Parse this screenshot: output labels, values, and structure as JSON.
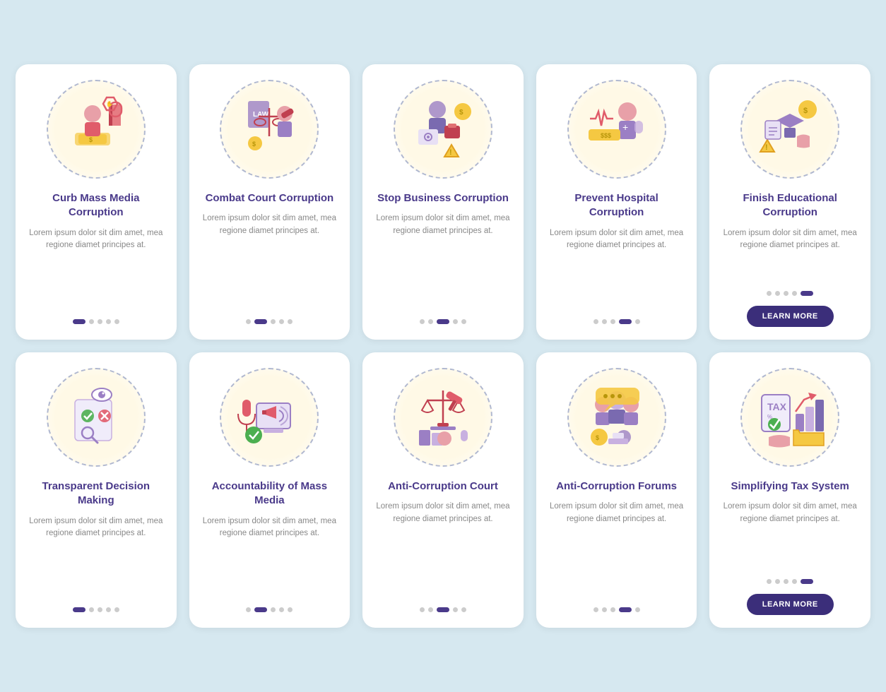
{
  "cards": [
    {
      "id": "curb-mass-media",
      "title": "Curb Mass Media Corruption",
      "body": "Lorem ipsum dolor sit dim amet, mea regione diamet principes at.",
      "dots": [
        true,
        false,
        false,
        false,
        false
      ],
      "has_button": false,
      "icon_color": "#e05c6a"
    },
    {
      "id": "combat-court",
      "title": "Combat Court Corruption",
      "body": "Lorem ipsum dolor sit dim amet, mea regione diamet principes at.",
      "dots": [
        false,
        true,
        false,
        false,
        false
      ],
      "has_button": false,
      "icon_color": "#e05c6a"
    },
    {
      "id": "stop-business",
      "title": "Stop Business Corruption",
      "body": "Lorem ipsum dolor sit dim amet, mea regione diamet principes at.",
      "dots": [
        false,
        false,
        true,
        false,
        false
      ],
      "has_button": false,
      "icon_color": "#e05c6a"
    },
    {
      "id": "prevent-hospital",
      "title": "Prevent Hospital Corruption",
      "body": "Lorem ipsum dolor sit dim amet, mea regione diamet principes at.",
      "dots": [
        false,
        false,
        false,
        true,
        false
      ],
      "has_button": false,
      "icon_color": "#9b7fc4"
    },
    {
      "id": "finish-educational",
      "title": "Finish Educational Corruption",
      "body": "Lorem ipsum dolor sit dim amet, mea regione diamet principes at.",
      "dots": [
        false,
        false,
        false,
        false,
        true
      ],
      "has_button": true,
      "button_label": "LEARN MORE",
      "icon_color": "#9b7fc4"
    },
    {
      "id": "transparent-decision",
      "title": "Transparent Decision Making",
      "body": "Lorem ipsum dolor sit dim amet, mea regione diamet principes at.",
      "dots": [
        true,
        false,
        false,
        false,
        false
      ],
      "has_button": false,
      "icon_color": "#e05c6a"
    },
    {
      "id": "accountability-mass-media",
      "title": "Accountability of Mass Media",
      "body": "Lorem ipsum dolor sit dim amet, mea regione diamet principes at.",
      "dots": [
        false,
        true,
        false,
        false,
        false
      ],
      "has_button": false,
      "icon_color": "#e05c6a"
    },
    {
      "id": "anti-corruption-court",
      "title": "Anti-Corruption Court",
      "body": "Lorem ipsum dolor sit dim amet, mea regione diamet principes at.",
      "dots": [
        false,
        false,
        true,
        false,
        false
      ],
      "has_button": false,
      "icon_color": "#e05c6a"
    },
    {
      "id": "anti-corruption-forums",
      "title": "Anti-Corruption Forums",
      "body": "Lorem ipsum dolor sit dim amet, mea regione diamet principes at.",
      "dots": [
        false,
        false,
        false,
        true,
        false
      ],
      "has_button": false,
      "icon_color": "#9b7fc4"
    },
    {
      "id": "simplifying-tax",
      "title": "Simplifying Tax System",
      "body": "Lorem ipsum dolor sit dim amet, mea regione diamet principes at.",
      "dots": [
        false,
        false,
        false,
        false,
        true
      ],
      "has_button": true,
      "button_label": "LEARN MORE",
      "icon_color": "#9b7fc4"
    }
  ]
}
